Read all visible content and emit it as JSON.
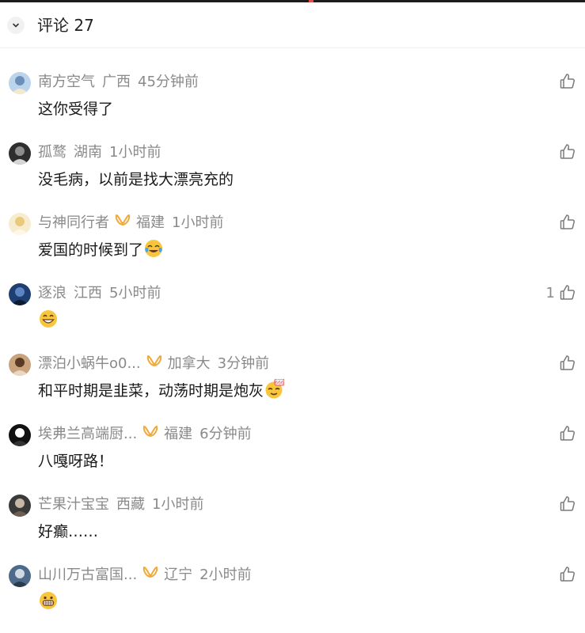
{
  "header": {
    "title": "评论 27",
    "collapse_icon": "chevron-down-icon"
  },
  "comments": [
    {
      "user": "南方空气",
      "has_badge": false,
      "location": "广西",
      "time": "45分钟前",
      "text": "这你受得了",
      "emoji": "",
      "likes": "",
      "avatar_colors": [
        "#bcd3ec",
        "#6a8fb8",
        "#f3e8d0"
      ]
    },
    {
      "user": "孤鹜",
      "has_badge": false,
      "location": "湖南",
      "time": "1小时前",
      "text": "没毛病，以前是找大漂亮充的",
      "emoji": "",
      "likes": "",
      "avatar_colors": [
        "#2e2e2e",
        "#8d8d8d",
        "#d6d6d6"
      ]
    },
    {
      "user": "与神同行者",
      "has_badge": true,
      "location": "福建",
      "time": "1小时前",
      "text": "爱国的时候到了",
      "emoji": "crying-laughing-face",
      "likes": "",
      "avatar_colors": [
        "#f7ecd0",
        "#e9c97a",
        "#fdf7e6"
      ]
    },
    {
      "user": "逐浪",
      "has_badge": false,
      "location": "江西",
      "time": "5小时前",
      "text": "",
      "emoji": "grinning-face",
      "likes": "1",
      "avatar_colors": [
        "#1f3f73",
        "#5c85c4",
        "#0d1c33"
      ]
    },
    {
      "user": "漂泊小蜗牛o0...",
      "has_badge": true,
      "location": "加拿大",
      "time": "3分钟前",
      "text": "和平时期是韭菜，动荡时期是炮灰",
      "emoji": "666-face",
      "likes": "",
      "avatar_colors": [
        "#c9a27e",
        "#5a3a22",
        "#e8d7c2"
      ]
    },
    {
      "user": "埃弗兰高端厨...",
      "has_badge": true,
      "location": "福建",
      "time": "6分钟前",
      "text": "八嘎呀路！",
      "emoji": "",
      "likes": "",
      "avatar_colors": [
        "#111111",
        "#ffffff",
        "#333333"
      ]
    },
    {
      "user": "芒果汁宝宝",
      "has_badge": false,
      "location": "西藏",
      "time": "1小时前",
      "text": "好癫……",
      "emoji": "",
      "likes": "",
      "avatar_colors": [
        "#3a3a3a",
        "#c8b6a6",
        "#6d5d52"
      ]
    },
    {
      "user": "山川万古富国...",
      "has_badge": true,
      "location": "辽宁",
      "time": "2小时前",
      "text": "",
      "emoji": "grimacing-face",
      "likes": "",
      "avatar_colors": [
        "#4d6a8a",
        "#cfd8e3",
        "#2b3b4e"
      ]
    }
  ],
  "like_icon": "thumbs-up-icon",
  "badge_icon": "fan-badge-icon",
  "colors": {
    "meta_text": "#8a8a8a",
    "badge": "#f0a93b",
    "content_text": "#1a1a1a"
  }
}
